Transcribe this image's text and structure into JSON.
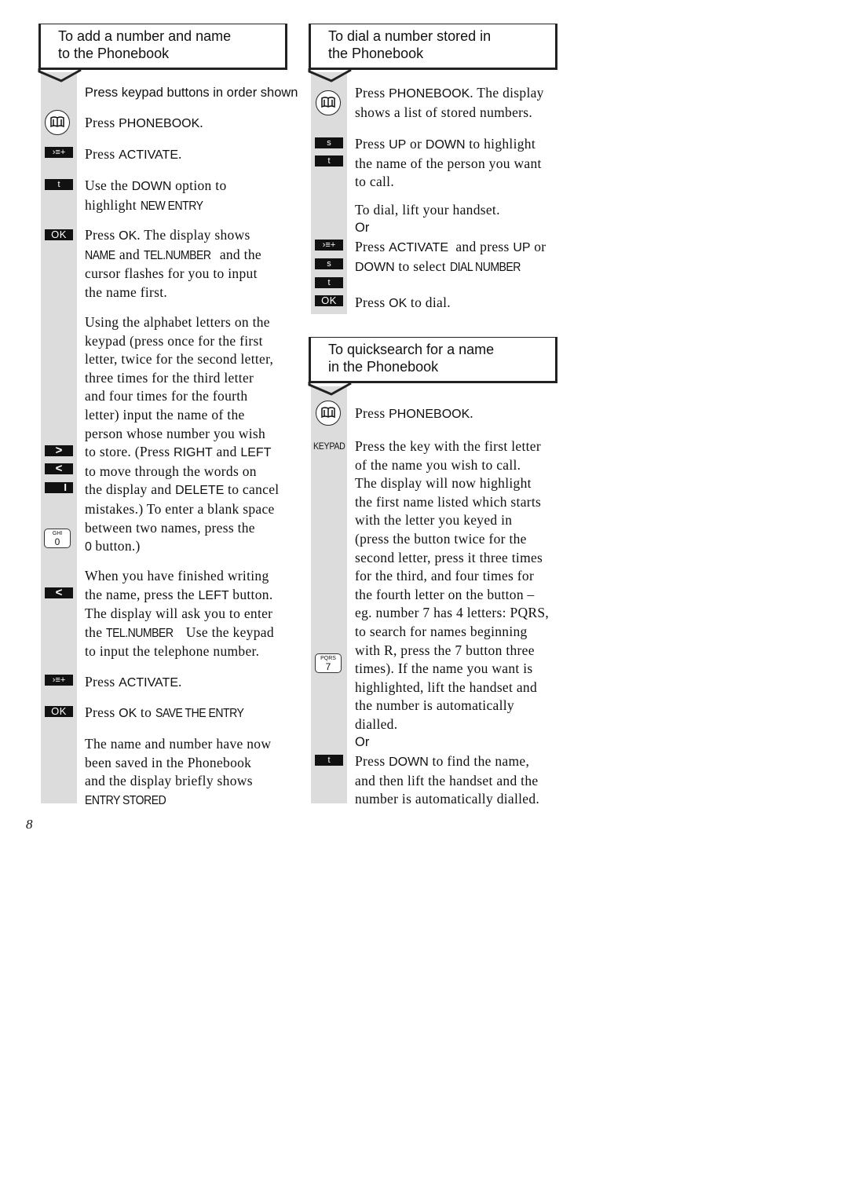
{
  "page_number": "8",
  "left_section": {
    "title_line1": "To add a number and name",
    "title_line2": "to the Phonebook",
    "intro": "Press keypad buttons in order shown",
    "steps": [
      {
        "icon": "phonebook-key",
        "lines": [
          "Press |PHONEBOOK|."
        ]
      },
      {
        "icon": "activate-key",
        "lines": [
          "Press |ACTIVATE|."
        ]
      },
      {
        "icon": "down-key",
        "key_label": "t",
        "lines": [
          "Use the |DOWN| option to",
          "highlight |NEW ENTRY|"
        ]
      },
      {
        "icon": "ok-key",
        "key_label": "OK",
        "lines": [
          "Press |OK|. The display shows",
          "|NAME|and |TEL.NUMBER|and the",
          "cursor flashes for you to input",
          "the name first."
        ]
      }
    ],
    "para_alphabet": [
      "Using the alphabet letters on the",
      "keypad (press once for the first",
      "letter, twice for the second letter,",
      "three times for the third letter",
      "and four times for the fourth",
      "letter) input the name of the",
      "person whose number you wish",
      "to store. (Press RIGHT and LEFT",
      "to move through the words on",
      "the display and DELETE to cancel",
      "mistakes.) To enter a blank space",
      "between two names, press the",
      "0 button.)"
    ],
    "right_key": ">",
    "left_key": "<",
    "delete_key": "I",
    "zero_key": {
      "letters": "GHI",
      "digit": "0"
    },
    "para_finished": [
      "When you have finished writing",
      "the name, press the LEFT button.",
      "The display will ask you to enter",
      "the TEL.NUMBER Use the keypad",
      "to input the telephone number."
    ],
    "step_activate_2": "Press ACTIVATE.",
    "step_ok_save": "Press OK to SAVE THE ENTRY",
    "para_saved": [
      "The name and number have now",
      "been saved in the Phonebook",
      "and the display briefly shows",
      "ENTRY STORED"
    ],
    "ok_label": "OK"
  },
  "right_top_section": {
    "title_line1": "To dial a number stored in",
    "title_line2": "the Phonebook",
    "step_phonebook": [
      "Press PHONEBOOK. The display",
      "shows a list of stored numbers."
    ],
    "up_key": "s",
    "down_key": "t",
    "step_updown": [
      "Press UP or DOWN to highlight",
      "the name of the person you want",
      "to call."
    ],
    "step_lift": "To dial, lift your handset.",
    "or_1": "Or",
    "step_activate": [
      "Press ACTIVATE and press UP or",
      "DOWN to select DIAL NUMBER"
    ],
    "ok_label": "OK",
    "step_ok": "Press OK to dial."
  },
  "right_bottom_section": {
    "title_line1": "To quicksearch for a name",
    "title_line2": "in the Phonebook",
    "step_phonebook": "Press PHONEBOOK.",
    "keypad_label": "KEYPAD",
    "para_keypad": [
      "Press the key with the first letter",
      "of the name you wish to call.",
      "The display will now highlight",
      "the first name listed which starts",
      "with the letter you keyed in",
      "(press the button twice for the",
      "second letter, press it three times",
      "for the third, and four times for",
      "the fourth letter on the button –",
      "eg. number 7 has 4 letters: PQRS,",
      "to search for names beginning",
      "with R, press the 7 button three",
      "times). If the name you want is",
      "highlighted, lift the handset and",
      "the number is automatically",
      "dialled."
    ],
    "seven_key": {
      "letters": "PQRS",
      "digit": "7"
    },
    "or_2": "Or",
    "down_key": "t",
    "step_down": [
      "Press DOWN to find the name,",
      "and then lift the handset and the",
      "number is automatically dialled."
    ]
  }
}
